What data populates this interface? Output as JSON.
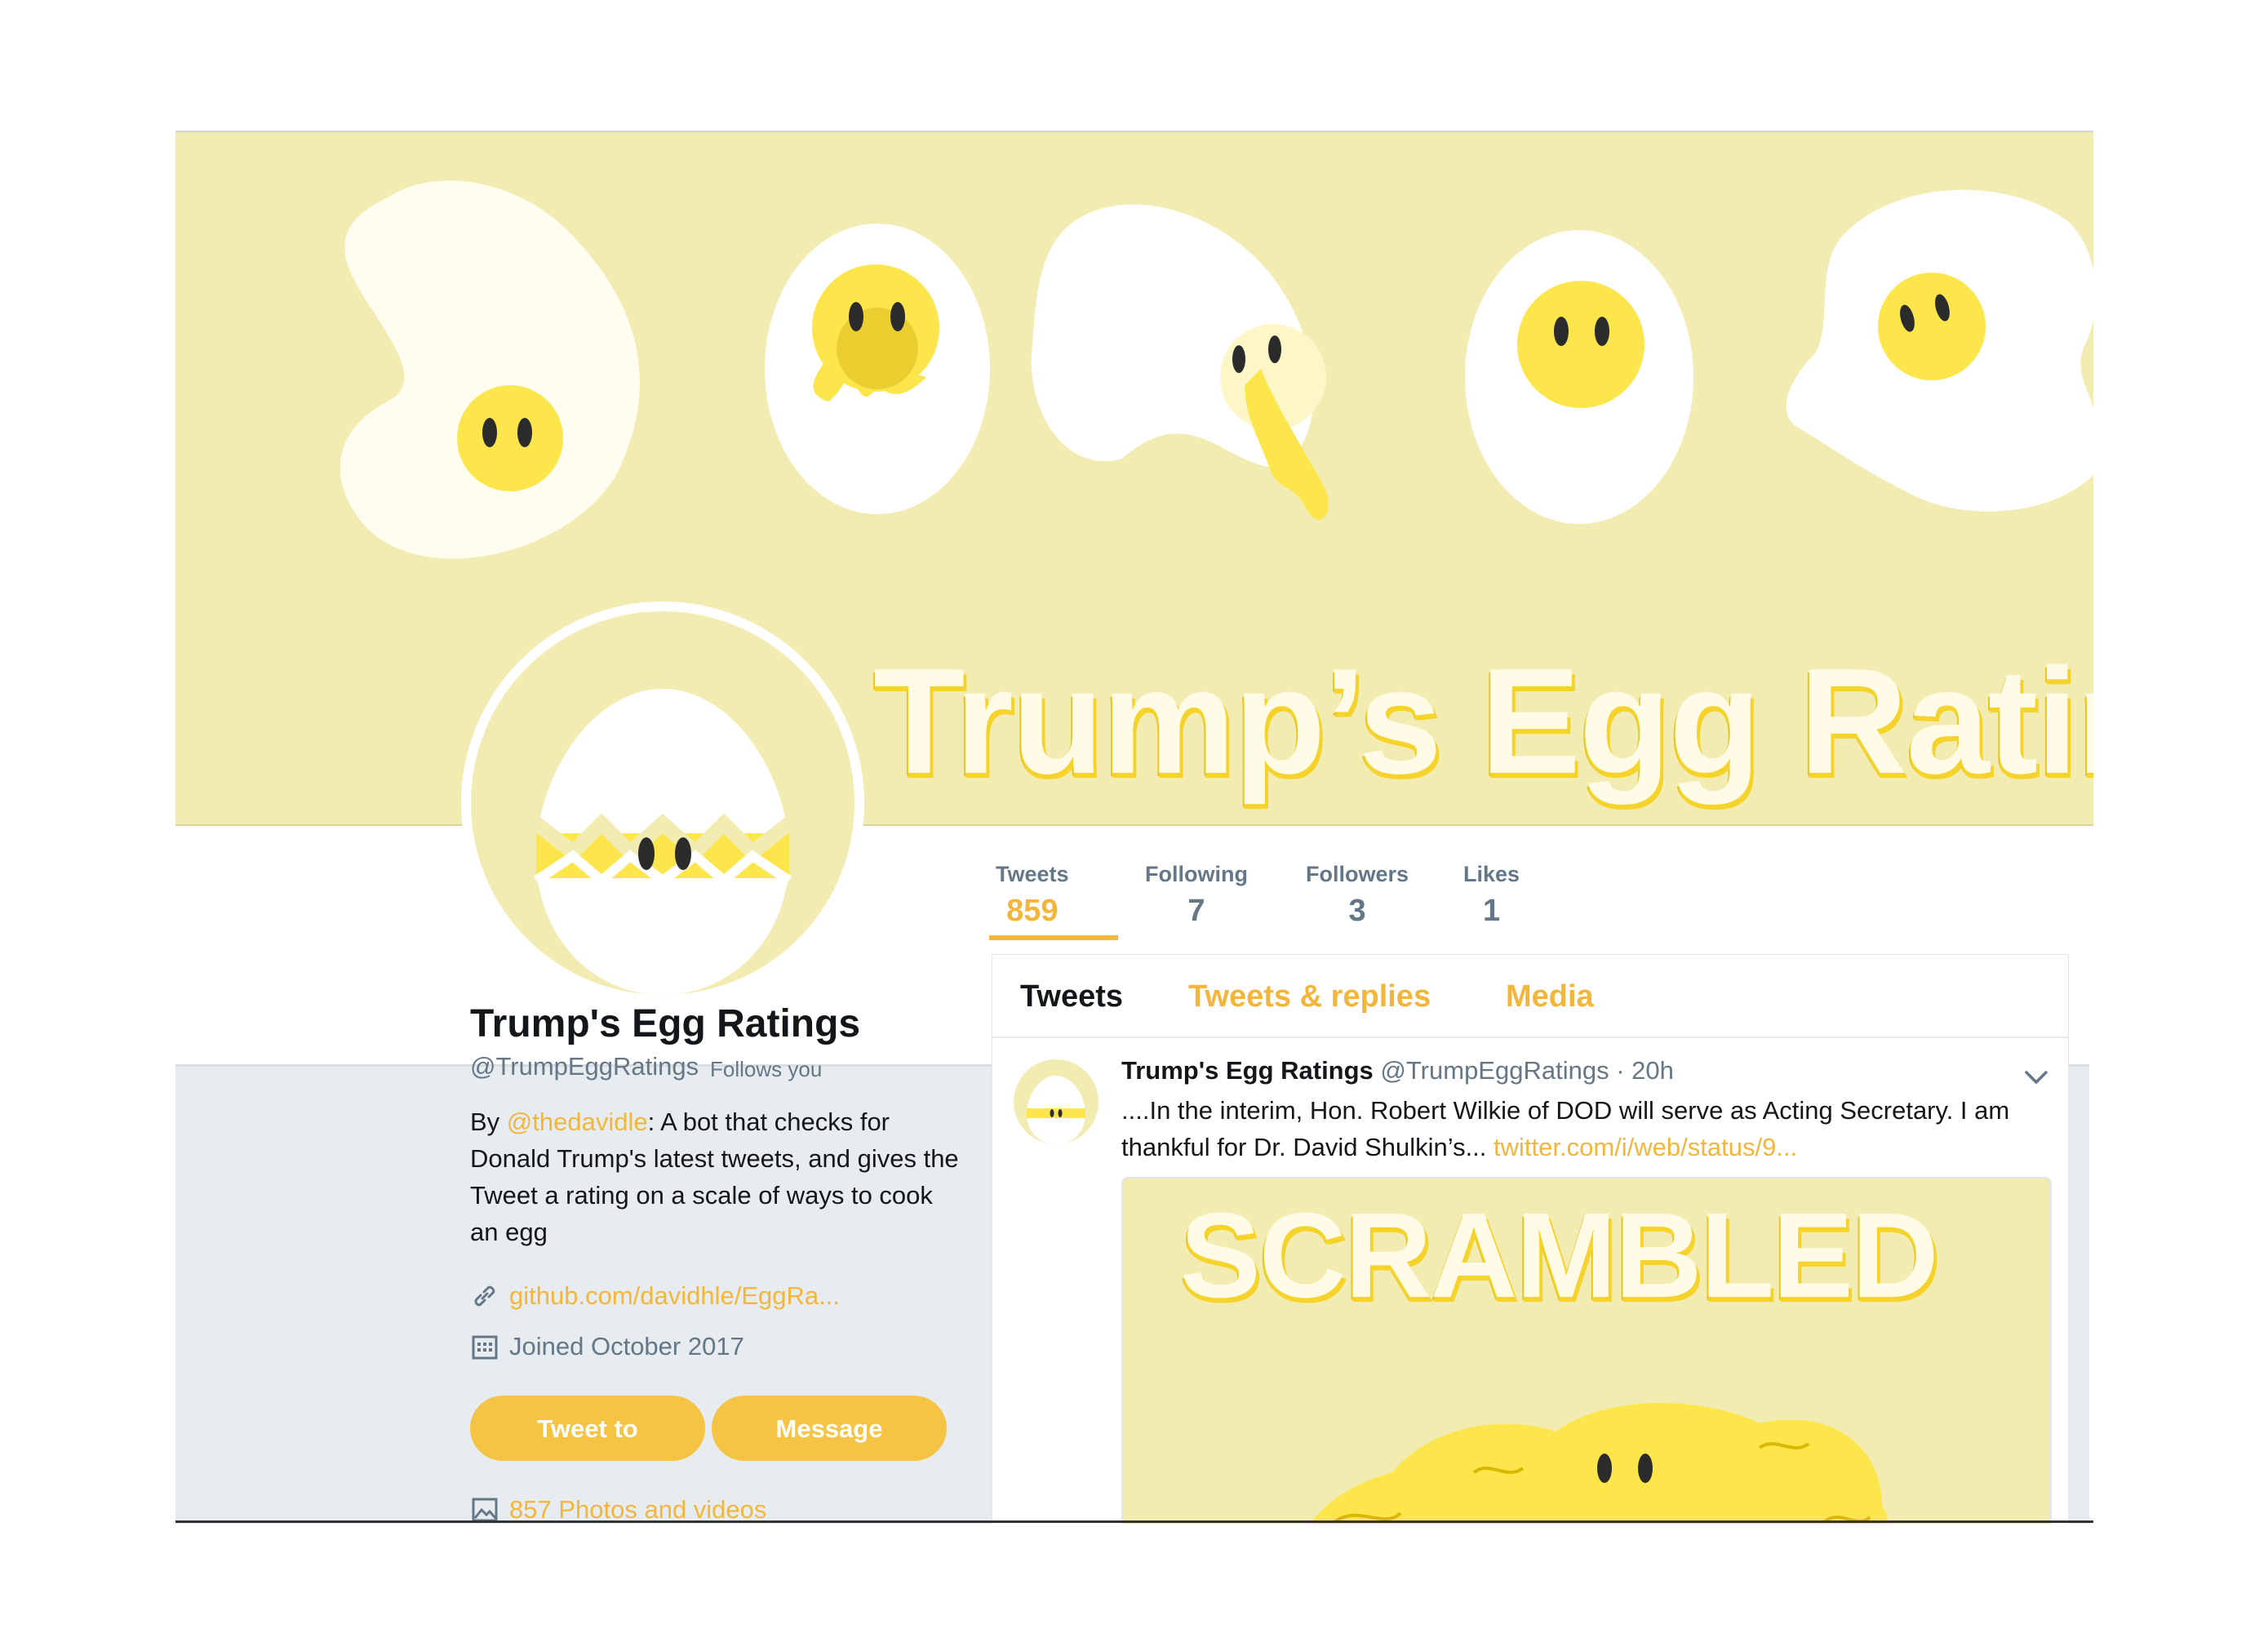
{
  "banner": {
    "title": "Trump’s Egg Ratin",
    "background": "#f3ecb2"
  },
  "stats": {
    "tweets_label": "Tweets",
    "tweets_value": "859",
    "following_label": "Following",
    "following_value": "7",
    "followers_label": "Followers",
    "followers_value": "3",
    "likes_label": "Likes",
    "likes_value": "1"
  },
  "profile": {
    "name": "Trump's Egg Ratings",
    "handle": "@TrumpEggRatings",
    "follows_you": "Follows you",
    "bio_prefix": "By ",
    "bio_link": "@thedavidle",
    "bio_text": ": A bot that checks for Donald Trump's latest tweets, and gives the Tweet a rating on a scale of ways to cook an egg",
    "url": "github.com/davidhle/EggRa...",
    "joined": "Joined October 2017",
    "tweet_to_label": "Tweet to",
    "message_label": "Message",
    "photos_label": "857 Photos and videos",
    "icons": {
      "url": "link-icon",
      "joined": "calendar-icon",
      "photos": "image-icon"
    }
  },
  "timeline": {
    "tabs": [
      "Tweets",
      "Tweets & replies",
      "Media"
    ],
    "tweet": {
      "name": "Trump's Egg Ratings",
      "handle": "@TrumpEggRatings",
      "dot": "·",
      "time": "20h",
      "text": "....In the interim, Hon. Robert Wilkie of DOD will serve as Acting Secretary. I am thankful for Dr. David Shulkin’s... ",
      "link": "twitter.com/i/web/status/9...",
      "media_word": "SCRAMBLED"
    }
  },
  "colors": {
    "accent": "#f4b63a",
    "button": "#f6c444",
    "banner": "#f3ecb2",
    "yolk": "#fde64b",
    "page_bg": "#e6ecf0",
    "muted_text": "#657786"
  }
}
